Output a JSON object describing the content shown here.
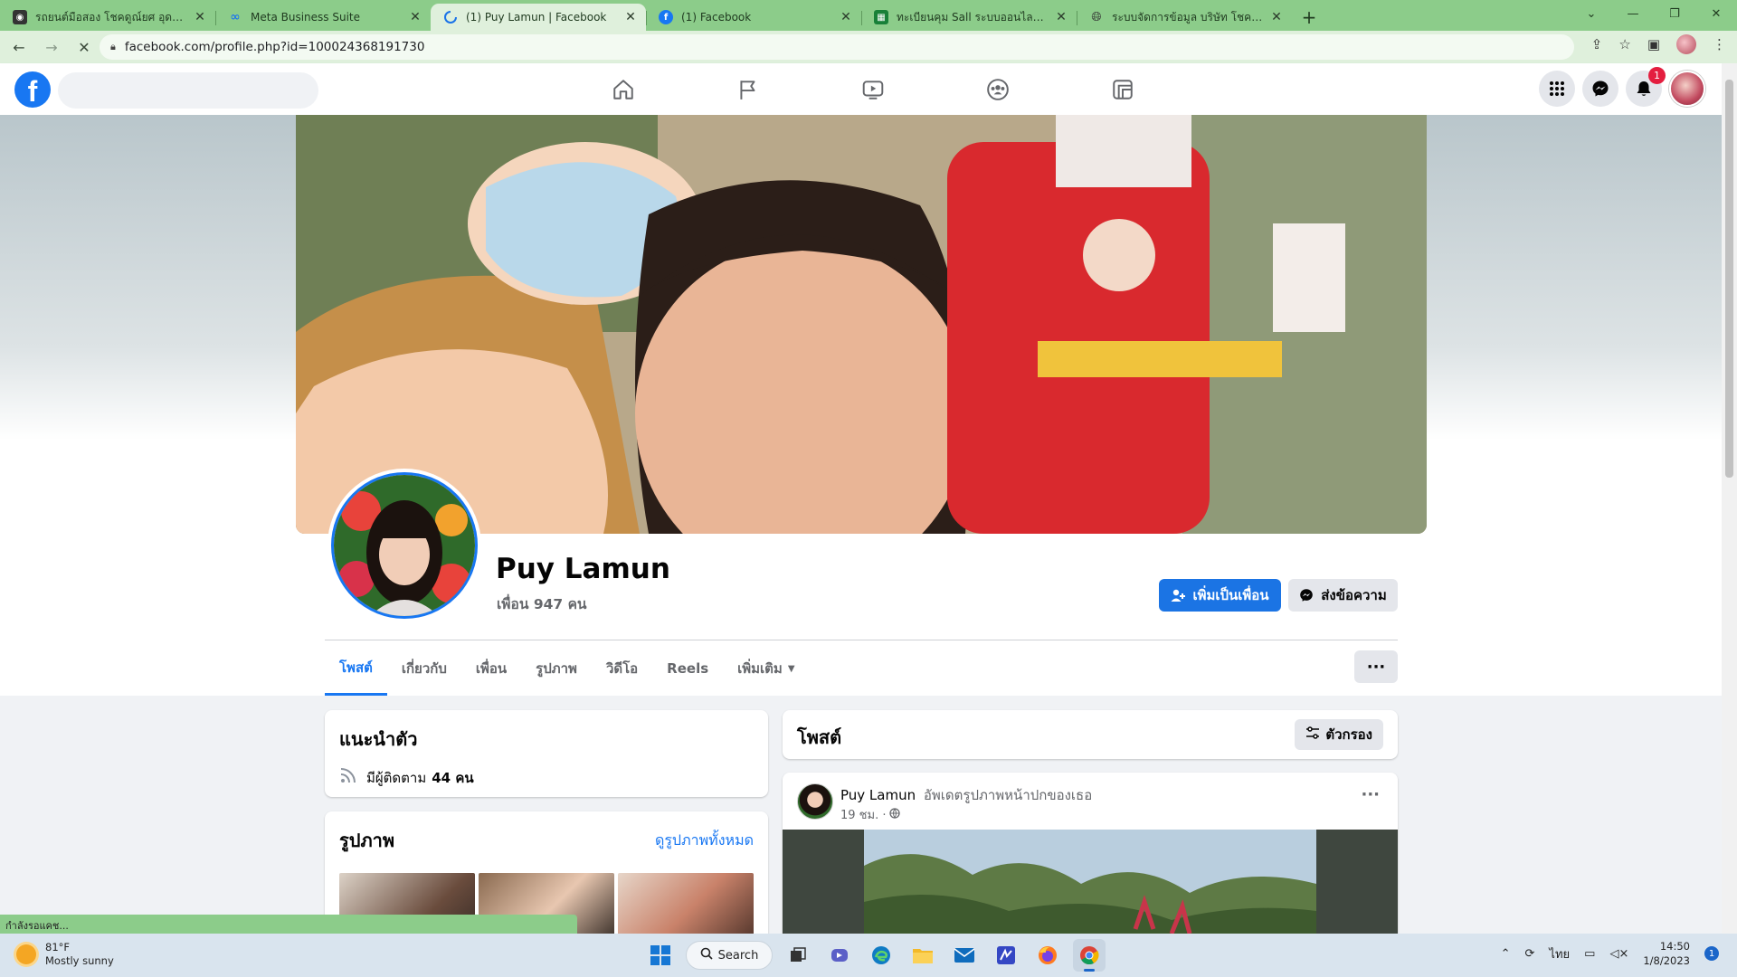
{
  "browser": {
    "tabs": [
      {
        "title": "รถยนต์มือสอง โชคดูณ์ยศ อุดรธานี",
        "favicon": "site-favicon",
        "active": false
      },
      {
        "title": "Meta Business Suite",
        "favicon": "meta-favicon",
        "active": false
      },
      {
        "title": "(1) Puy Lamun | Facebook",
        "favicon": "loading-spinner",
        "active": true
      },
      {
        "title": "(1) Facebook",
        "favicon": "facebook-favicon",
        "active": false
      },
      {
        "title": "ทะเบียนคุม Sall ระบบออนไลน์.xlsx - G",
        "favicon": "sheets-favicon",
        "active": false
      },
      {
        "title": "ระบบจัดการข้อมูล บริษัท โชคดูณ์ยศ",
        "favicon": "globe-favicon",
        "active": false
      }
    ],
    "url": "facebook.com/profile.php?id=100024368191730",
    "status_text": "กำลังรอแคช..."
  },
  "facebook": {
    "notifications_count": "1",
    "profile": {
      "name": "Puy Lamun",
      "friends": "เพื่อน 947 คน",
      "add_friend_label": "เพิ่มเป็นเพื่อน",
      "message_label": "ส่งข้อความ"
    },
    "tabs": [
      "โพสต์",
      "เกี่ยวกับ",
      "เพื่อน",
      "รูปภาพ",
      "วิดีโอ",
      "Reels",
      "เพิ่มเติม"
    ],
    "intro": {
      "title": "แนะนำตัว",
      "followers_prefix": "มีผู้ติดตาม",
      "followers_count": "44 คน"
    },
    "photos": {
      "title": "รูปภาพ",
      "see_all": "ดูรูปภาพทั้งหมด"
    },
    "posts": {
      "title": "โพสต์",
      "filter_label": "ตัวกรอง"
    },
    "post": {
      "author": "Puy Lamun",
      "action": "อัพเดตรูปภาพหน้าปกของเธอ",
      "time": "19 ชม. ·"
    }
  },
  "taskbar": {
    "weather_temp": "81°F",
    "weather_desc": "Mostly sunny",
    "search_label": "Search",
    "language": "ไทย",
    "time": "14:50",
    "date": "1/8/2023",
    "notification_count": "1"
  },
  "colors": {
    "fb_blue": "#1877f2",
    "chrome_frame": "#8ccc8a",
    "notification_red": "#e41e3f"
  }
}
